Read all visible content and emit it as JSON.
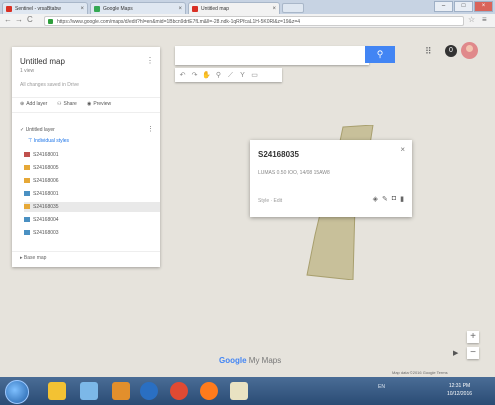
{
  "browser": {
    "tabs": [
      {
        "label": "Sentinel - vrsaBtabw",
        "color": "#d93025",
        "active": false
      },
      {
        "label": "Google Maps",
        "color": "#34a853",
        "active": false
      },
      {
        "label": "Untitled map",
        "color": "#d93025",
        "active": true
      }
    ],
    "url": "https://www.google.com/maps/d/edit?hl=en&mid=1Bbcn9drtE7fLm&ll=-28.ndk-1qRPfcaL1H-5K0Rl&z=19&z=4",
    "window_buttons": [
      "–",
      "□",
      "×"
    ]
  },
  "panel": {
    "map_title": "Untitled map",
    "view_count": "1 view",
    "description": "All changes saved in Drive",
    "actions": {
      "add_layer": "Add layer",
      "share": "Share",
      "preview": "Preview"
    },
    "layer_name": "Untitled layer",
    "styles_link": "Individual styles",
    "features": [
      {
        "label": "S24168001",
        "color": "#c0504d"
      },
      {
        "label": "S24168005",
        "color": "#e6a837"
      },
      {
        "label": "S24168006",
        "color": "#e6a837"
      },
      {
        "label": "S24168001",
        "color": "#4a90c2"
      },
      {
        "label": "S24168035",
        "color": "#e6a837",
        "selected": true
      },
      {
        "label": "S24168004",
        "color": "#4a90c2"
      },
      {
        "label": "S24168003",
        "color": "#4a90c2"
      }
    ],
    "base_map": "Base map"
  },
  "search": {
    "placeholder": ""
  },
  "popup": {
    "title": "S24168035",
    "description": "LUMAS 0.50 IOO, 14/08 15AW8",
    "footer": "Style ·  Edit"
  },
  "map": {
    "brand_g": "Google",
    "brand_m": " My Maps",
    "terms": "Map data ©2016 Google   Terms",
    "field_color": "#c8c09a"
  },
  "taskbar": {
    "tray_text": "EN",
    "time": "12:31 PM",
    "date": "10/12/2016"
  }
}
